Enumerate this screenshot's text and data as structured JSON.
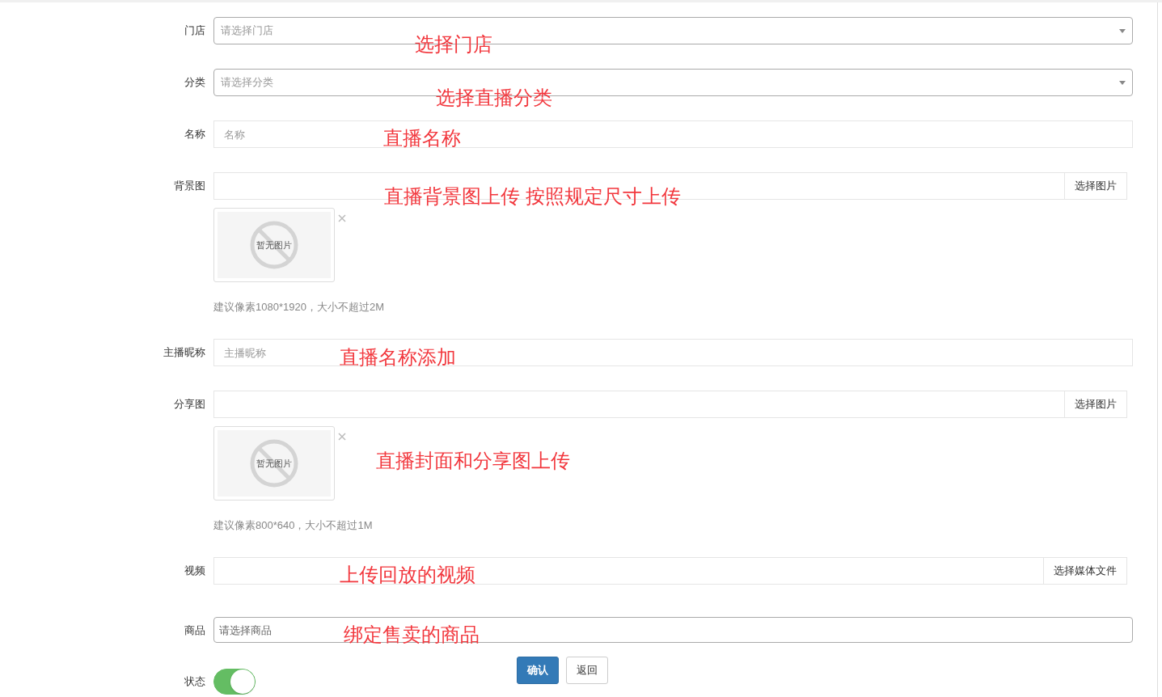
{
  "fields": [
    {
      "kind": "select",
      "label": "门店",
      "placeholder": "请选择门店",
      "annotation": "选择门店"
    },
    {
      "kind": "select",
      "label": "分类",
      "placeholder": "请选择分类",
      "annotation": "选择直播分类"
    },
    {
      "kind": "text",
      "label": "名称",
      "placeholder": "名称",
      "annotation": "直播名称"
    },
    {
      "kind": "image",
      "label": "背景图",
      "button": "选择图片",
      "empty_text": "暂无图片",
      "hint": "建议像素1080*1920，大小不超过2M",
      "annotation": "直播背景图上传 按照规定尺寸上传"
    },
    {
      "kind": "text",
      "label": "主播昵称",
      "placeholder": "主播昵称",
      "annotation": "直播名称添加"
    },
    {
      "kind": "image",
      "label": "分享图",
      "button": "选择图片",
      "empty_text": "暂无图片",
      "hint": "建议像素800*640，大小不超过1M",
      "annotation": "直播封面和分享图上传"
    },
    {
      "kind": "file",
      "label": "视频",
      "button": "选择媒体文件",
      "annotation": "上传回放的视频"
    },
    {
      "kind": "product",
      "label": "商品",
      "placeholder": "请选择商品",
      "annotation": "绑定售卖的商品"
    }
  ],
  "status": {
    "label": "状态",
    "on": true
  },
  "buttons": [
    {
      "kind": "primary",
      "label": "确认"
    },
    {
      "kind": "default",
      "label": "返回"
    }
  ]
}
